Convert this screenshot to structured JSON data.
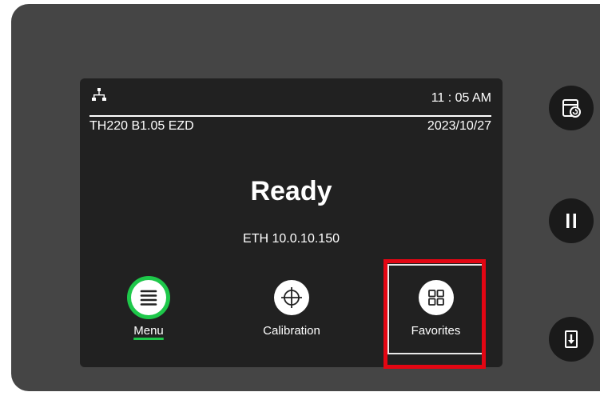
{
  "header": {
    "time": "11 : 05 AM",
    "model": "TH220 B1.05 EZD",
    "date": "2023/10/27"
  },
  "status": {
    "title": "Ready",
    "network": "ETH 10.0.10.150"
  },
  "tiles": [
    {
      "label": "Menu",
      "icon": "menu-icon",
      "selected": true
    },
    {
      "label": "Calibration",
      "icon": "crosshair-icon"
    },
    {
      "label": "Favorites",
      "icon": "grid-icon",
      "highlighted": true
    }
  ],
  "side_buttons": [
    {
      "icon": "feed-paper-icon"
    },
    {
      "icon": "pause-icon"
    },
    {
      "icon": "cancel-icon"
    }
  ],
  "colors": {
    "accent_green": "#1ec84a",
    "highlight_red": "#e30613",
    "screen_bg": "#212121",
    "device_bg": "#454545"
  }
}
